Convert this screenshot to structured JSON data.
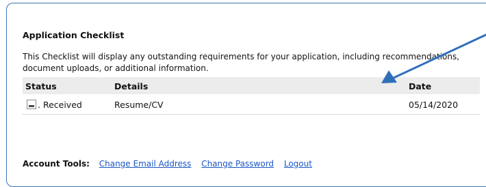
{
  "checklist": {
    "title": "Application Checklist",
    "description": "This Checklist will display any outstanding requirements for your application, including recommendations, document uploads, or additional information.",
    "columns": {
      "status": "Status",
      "details": "Details",
      "date": "Date"
    },
    "rows": [
      {
        "status": ". Received",
        "details": "Resume/CV",
        "date": "05/14/2020"
      }
    ]
  },
  "account_tools": {
    "label": "Account Tools:",
    "links": [
      "Change Email Address",
      "Change Password",
      "Logout"
    ]
  },
  "colors": {
    "link": "#1a56c4",
    "frame_border": "#3a74b6",
    "annotation_arrow": "#2f6fba",
    "header_bg": "#ececec"
  },
  "icons": {
    "status": "document-icon",
    "annotation": "arrow-icon"
  }
}
